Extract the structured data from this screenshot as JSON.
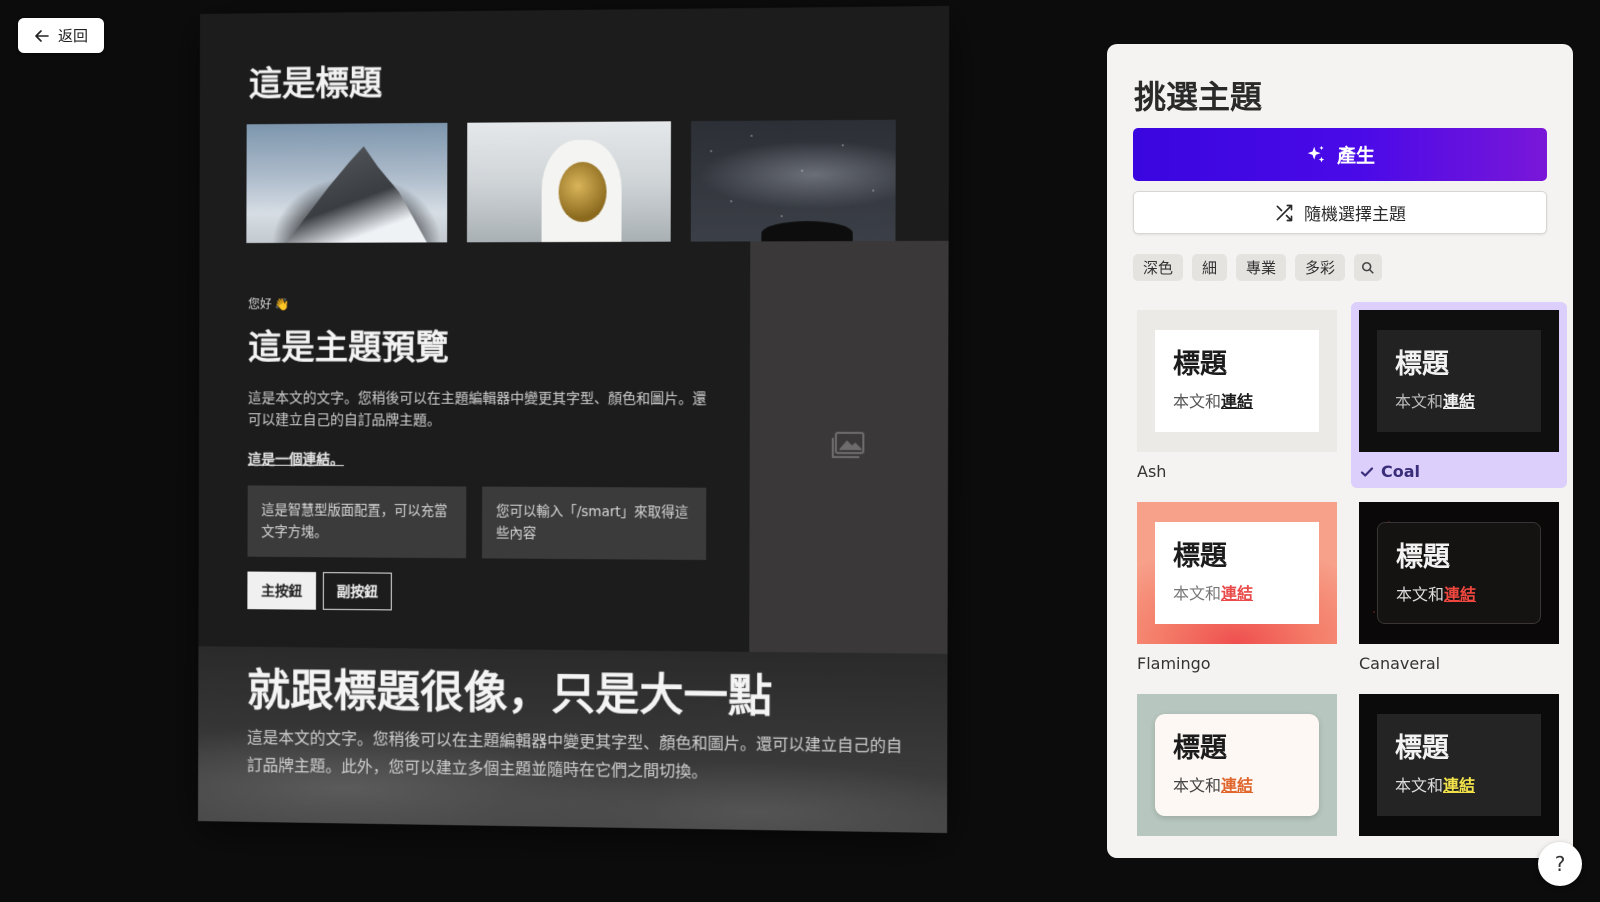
{
  "back_button": {
    "label": "返回"
  },
  "preview": {
    "title": "這是標題",
    "images": [
      "mountain-photo",
      "astronaut-photo",
      "starry-sky-photo"
    ],
    "hello": "您好 👋",
    "heading": "這是主題預覽",
    "body": "這是本文的文字。您稍後可以在主題編輯器中變更其字型、顏色和圖片。還可以建立自己的自訂品牌主題。",
    "link": "這是一個連結。",
    "smart_box_1": "這是智慧型版面配置，可以充當文字方塊。",
    "smart_box_2": "您可以輸入「/smart」來取得這些內容",
    "primary_button": "主按鈕",
    "secondary_button": "副按鈕",
    "big_heading": "就跟標題很像，只是大一點",
    "bottom_body": "這是本文的文字。您稍後可以在主題編輯器中變更其字型、顏色和圖片。還可以建立自己的自訂品牌主題。此外，您可以建立多個主題並隨時在它們之間切換。"
  },
  "panel": {
    "title": "挑選主題",
    "generate_button": "產生",
    "random_button": "隨機選擇主題",
    "filters": [
      "深色",
      "細",
      "專業",
      "多彩"
    ],
    "themes": [
      {
        "name": "Ash",
        "card_title": "標題",
        "card_body": "本文和",
        "card_link": "連結",
        "selected": false
      },
      {
        "name": "Coal",
        "card_title": "標題",
        "card_body": "本文和",
        "card_link": "連結",
        "selected": true
      },
      {
        "name": "Flamingo",
        "card_title": "標題",
        "card_body": "本文和",
        "card_link": "連結",
        "selected": false
      },
      {
        "name": "Canaveral",
        "card_title": "標題",
        "card_body": "本文和",
        "card_link": "連結",
        "selected": false
      },
      {
        "name": "",
        "card_title": "標題",
        "card_body": "本文和",
        "card_link": "連結",
        "selected": false
      },
      {
        "name": "",
        "card_title": "標題",
        "card_body": "本文和",
        "card_link": "連結",
        "selected": false
      }
    ]
  },
  "help_button": {
    "label": "?"
  },
  "colors": {
    "accent": "#4a0ae8",
    "selected_bg": "#dccffc",
    "panel_bg": "#f4f3f1"
  }
}
